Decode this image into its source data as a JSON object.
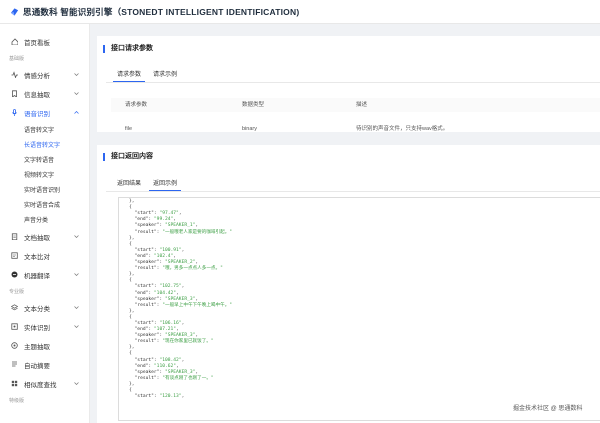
{
  "app": {
    "title": "思通数科 智能识别引擎（STONEDT INTELLIGENT IDENTIFICATION)"
  },
  "sidebar": {
    "items": [
      {
        "label": "首页看板",
        "icon": "home-icon"
      },
      {
        "group": "基础版"
      },
      {
        "label": "情感分析",
        "icon": "pulse-icon",
        "chevron": true
      },
      {
        "label": "信息抽取",
        "icon": "bookmark-icon",
        "chevron": true
      },
      {
        "label": "语音识别",
        "icon": "mic-icon",
        "chevron": true,
        "active": true
      },
      {
        "sub": "语音转文字"
      },
      {
        "sub": "长语音转文字",
        "active": true
      },
      {
        "sub": "文字转语音"
      },
      {
        "sub": "视频转文字"
      },
      {
        "sub": "实时语音识别"
      },
      {
        "sub": "实时语音合成"
      },
      {
        "sub": "声音分类"
      },
      {
        "label": "文档抽取",
        "icon": "doc-icon",
        "chevron": true
      },
      {
        "label": "文本比对",
        "icon": "compare-icon"
      },
      {
        "label": "机器翻译",
        "icon": "translate-icon",
        "chevron": true
      },
      {
        "group": "专业版"
      },
      {
        "label": "文本分类",
        "icon": "layers-icon",
        "chevron": true
      },
      {
        "label": "实体识别",
        "icon": "entity-icon",
        "chevron": true
      },
      {
        "label": "主题抽取",
        "icon": "topic-icon"
      },
      {
        "label": "自动摘要",
        "icon": "summary-icon"
      },
      {
        "label": "相似度查找",
        "icon": "search-grid-icon",
        "chevron": true
      },
      {
        "group": "特级版"
      }
    ]
  },
  "request": {
    "title": "接口请求参数",
    "tabs": [
      "请求参数",
      "请求示例"
    ],
    "headers": [
      "请求参数",
      "数据类型",
      "描述"
    ],
    "rows": [
      [
        "file",
        "binary",
        "待识别的声音文件，只支持wav格式。"
      ]
    ]
  },
  "response": {
    "title": "接口返回内容",
    "tabs": [
      "返回结果",
      "返回示例"
    ],
    "code_lines": [
      "  \"result\": \"一直都很不错。\"",
      "},",
      "{",
      "  \"start\": \"97.47\",",
      "  \"end\": \"99.24\",",
      "  \"speaker\": \"SPEAKER_1\",",
      "  \"result\": \"一般哦老人家是要的咖啡引起。\"",
      "},",
      "{",
      "  \"start\": \"100.91\",",
      "  \"end\": \"102.4\",",
      "  \"speaker\": \"SPEAKER_2\",",
      "  \"result\": \"哦，男多一点点人多一点。\"",
      "},",
      "{",
      "  \"start\": \"102.75\",",
      "  \"end\": \"104.42\",",
      "  \"speaker\": \"SPEAKER_3\",",
      "  \"result\": \"一般早上中午下午晚上喝中午。\"",
      "},",
      "{",
      "  \"start\": \"106.16\",",
      "  \"end\": \"107.21\",",
      "  \"speaker\": \"SPEAKER_3\",",
      "  \"result\": \"现在你家里已就饭了。\"",
      "},",
      "{",
      "  \"start\": \"108.42\",",
      "  \"end\": \"110.62\",",
      "  \"speaker\": \"SPEAKER_3\",",
      "  \"result\": \"有谈点刚了也刚了一。\"",
      "},",
      "{",
      "  \"start\": \"120.13\","
    ]
  },
  "watermark": {
    "text": "掘金技术社区 @ 思通数科"
  },
  "colors": {
    "accent": "#2d66f0",
    "code_string": "#3b9e43"
  }
}
